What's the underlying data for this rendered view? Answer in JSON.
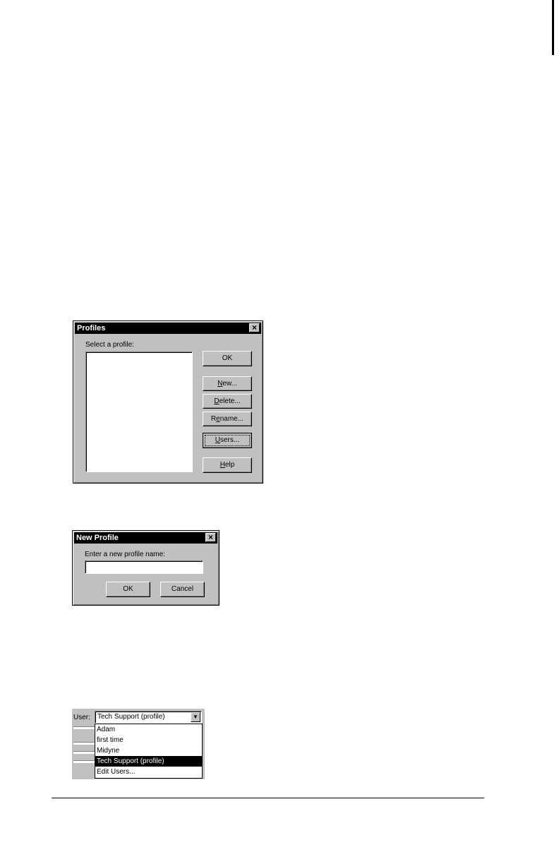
{
  "profiles_dialog": {
    "title": "Profiles",
    "close": "×",
    "select_label": "Select a profile:",
    "ok": "OK",
    "new_pre": "",
    "new_u": "N",
    "new_post": "ew...",
    "delete_pre": "",
    "delete_u": "D",
    "delete_post": "elete...",
    "rename_pre": "R",
    "rename_u": "e",
    "rename_post": "name...",
    "users_pre": "",
    "users_u": "U",
    "users_post": "sers...",
    "help_pre": "",
    "help_u": "H",
    "help_post": "elp"
  },
  "new_profile_dialog": {
    "title": "New Profile",
    "close": "×",
    "prompt": "Enter a new profile name:",
    "input_value": "",
    "ok": "OK",
    "cancel": "Cancel"
  },
  "user_selector": {
    "label": "User:",
    "selected": "Tech Support (profile)",
    "arrow": "▼",
    "options": [
      "Adam",
      "first time",
      "Midyne",
      "Tech Support (profile)",
      "Edit Users..."
    ],
    "highlighted_index": 3
  }
}
